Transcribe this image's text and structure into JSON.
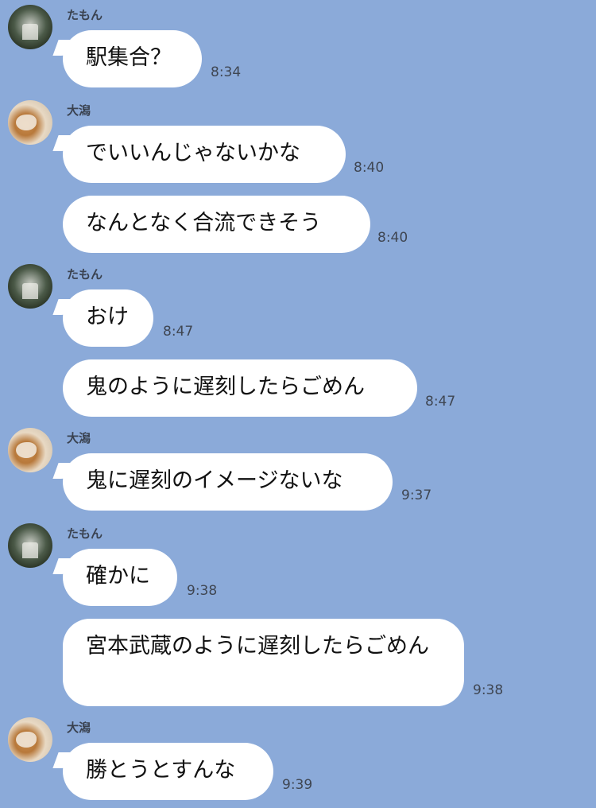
{
  "theme": {
    "background": "#8BAAD9",
    "bubble": "#FFFFFF"
  },
  "senders": {
    "tamon": "たもん",
    "ogata": "大潟"
  },
  "messages": [
    {
      "text": "駅集合？",
      "time": "8:34"
    },
    {
      "text": "でいいんじゃないかな",
      "time": "8:40"
    },
    {
      "text": "なんとなく合流できそう",
      "time": "8:40"
    },
    {
      "text": "おけ",
      "time": "8:47"
    },
    {
      "text": "鬼のように遅刻したらごめん",
      "time": "8:47"
    },
    {
      "text": "鬼に遅刻のイメージないな",
      "time": "9:37"
    },
    {
      "text": "確かに",
      "time": "9:38"
    },
    {
      "text": "宮本武蔵のように遅刻したらごめん",
      "time": "9:38"
    },
    {
      "text": "勝とうとすんな",
      "time": "9:39"
    }
  ]
}
